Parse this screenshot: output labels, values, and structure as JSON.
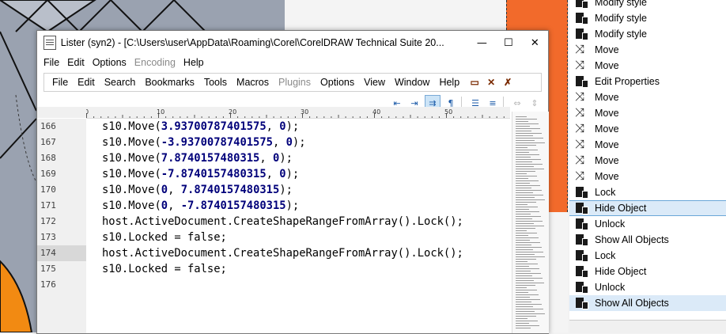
{
  "window": {
    "title": "Lister (syn2) - [C:\\Users\\user\\AppData\\Roaming\\Corel\\CorelDRAW Technical Suite 20...",
    "minimize": "—",
    "maximize": "☐",
    "close": "✕"
  },
  "menu1": [
    "File",
    "Edit",
    "Options",
    "Encoding",
    "Help"
  ],
  "menu2": [
    "File",
    "Edit",
    "Search",
    "Bookmarks",
    "Tools",
    "Macros",
    "Plugins",
    "Options",
    "View",
    "Window",
    "Help"
  ],
  "ruler": {
    "labels": [
      "0",
      "10",
      "20",
      "30",
      "40",
      "50"
    ]
  },
  "editor": {
    "lines": [
      {
        "n": "166",
        "text": "s10.Move(3.93700787401575, 0);"
      },
      {
        "n": "167",
        "text": "s10.Move(-3.93700787401575, 0);"
      },
      {
        "n": "168",
        "text": "s10.Move(7.8740157480315, 0);"
      },
      {
        "n": "169",
        "text": "s10.Move(-7.8740157480315, 0);"
      },
      {
        "n": "170",
        "text": "s10.Move(0, 7.8740157480315);"
      },
      {
        "n": "171",
        "text": "s10.Move(0, -7.8740157480315);"
      },
      {
        "n": "172",
        "text": "host.ActiveDocument.CreateShapeRangeFromArray().Lock();"
      },
      {
        "n": "173",
        "text": "s10.Locked = false;"
      },
      {
        "n": "174",
        "text": "host.ActiveDocument.CreateShapeRangeFromArray().Lock();"
      },
      {
        "n": "175",
        "text": "s10.Locked = false;"
      },
      {
        "n": "176",
        "text": ""
      }
    ],
    "current_line": "174"
  },
  "history": {
    "items": [
      {
        "label": "Modify style",
        "icon": "doc-icon"
      },
      {
        "label": "Modify style",
        "icon": "doc-icon"
      },
      {
        "label": "Modify style",
        "icon": "doc-icon"
      },
      {
        "label": "Move",
        "icon": "move-icon"
      },
      {
        "label": "Move",
        "icon": "move-icon"
      },
      {
        "label": "Edit Properties",
        "icon": "doc-icon"
      },
      {
        "label": "Move",
        "icon": "move-icon"
      },
      {
        "label": "Move",
        "icon": "move-icon"
      },
      {
        "label": "Move",
        "icon": "move-icon"
      },
      {
        "label": "Move",
        "icon": "move-icon"
      },
      {
        "label": "Move",
        "icon": "move-icon"
      },
      {
        "label": "Move",
        "icon": "move-icon"
      },
      {
        "label": "Lock",
        "icon": "doc-icon"
      },
      {
        "label": "Hide Object",
        "icon": "doc-icon"
      },
      {
        "label": "Unlock",
        "icon": "doc-icon"
      },
      {
        "label": "Show All Objects",
        "icon": "doc-icon"
      },
      {
        "label": "Lock",
        "icon": "doc-icon"
      },
      {
        "label": "Hide Object",
        "icon": "doc-icon"
      },
      {
        "label": "Unlock",
        "icon": "doc-icon"
      },
      {
        "label": "Show All Objects",
        "icon": "doc-icon"
      }
    ],
    "selected_index": 13,
    "highlighted_index": 19
  },
  "colors": {
    "orange": "#f26a2b",
    "accent_selection": "#dbeaf8",
    "number_color": "#00007a"
  }
}
